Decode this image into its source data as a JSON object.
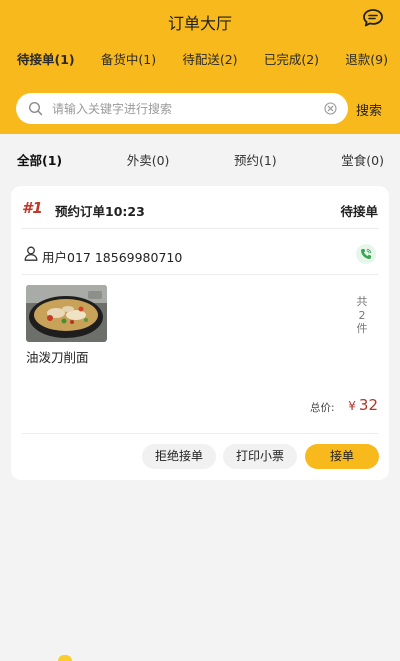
{
  "header": {
    "title": "订单大厅"
  },
  "status_tabs": [
    {
      "label": "待接单(1)",
      "active": true
    },
    {
      "label": "备货中(1)",
      "active": false
    },
    {
      "label": "待配送(2)",
      "active": false
    },
    {
      "label": "已完成(2)",
      "active": false
    },
    {
      "label": "退款(9)",
      "active": false
    }
  ],
  "search": {
    "placeholder": "请输入关键字进行搜索",
    "value": "",
    "button_label": "搜索"
  },
  "type_tabs": [
    {
      "label": "全部(1)",
      "active": true
    },
    {
      "label": "外卖(0)",
      "active": false
    },
    {
      "label": "预约(1)",
      "active": false
    },
    {
      "label": "堂食(0)",
      "active": false
    }
  ],
  "order": {
    "number": "#1",
    "title": "预约订单10:23",
    "status": "待接单",
    "user": "用户017 18569980710",
    "item_name": "油泼刀削面",
    "qty_chars": [
      "共",
      "2",
      "件"
    ],
    "total_label": "总价:",
    "currency": "¥",
    "total": "32",
    "buttons": {
      "reject": "拒绝接单",
      "print": "打印小票",
      "accept": "接单"
    }
  },
  "colors": {
    "brand": "#f8b91c",
    "price": "#b0352b",
    "order_no": "#c0392b",
    "phone": "#3aa655"
  },
  "icons": [
    "message-icon",
    "search-icon",
    "clear-icon",
    "user-icon",
    "phone-icon"
  ]
}
